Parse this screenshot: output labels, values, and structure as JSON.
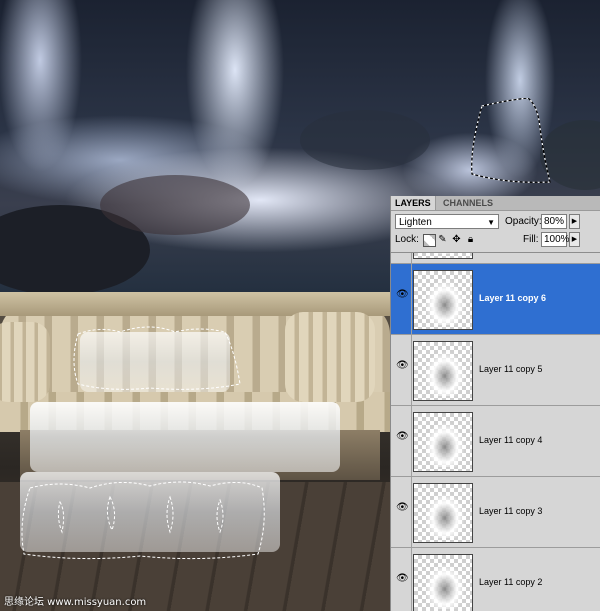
{
  "panel": {
    "tabs": [
      "LAYERS",
      "CHANNELS"
    ],
    "blend_mode": "Lighten",
    "opacity_label": "Opacity:",
    "opacity_value": "80%",
    "lock_label": "Lock:",
    "fill_label": "Fill:",
    "fill_value": "100%",
    "lock_icons": [
      "lock-transparent-icon",
      "lock-image-icon",
      "lock-position-icon",
      "lock-all-icon"
    ],
    "layers": [
      {
        "name": "",
        "visible": true,
        "selected": false
      },
      {
        "name": "Layer 11 copy 6",
        "visible": true,
        "selected": true
      },
      {
        "name": "Layer 11 copy 5",
        "visible": true,
        "selected": false
      },
      {
        "name": "Layer 11 copy 4",
        "visible": true,
        "selected": false
      },
      {
        "name": "Layer 11 copy 3",
        "visible": true,
        "selected": false
      },
      {
        "name": "Layer 11 copy 2",
        "visible": true,
        "selected": false
      }
    ],
    "selected_color": "#2f6fd1"
  },
  "watermark": "思缘论坛 www.missyuan.com"
}
